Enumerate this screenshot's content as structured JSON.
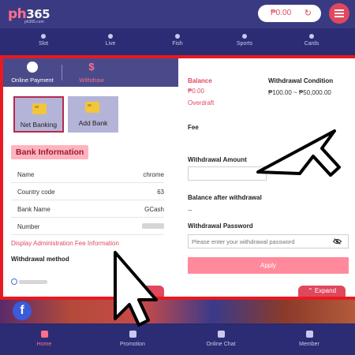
{
  "header": {
    "logo_main": "ph",
    "logo_num": "365",
    "logo_sub": "ph365.com",
    "balance": "₱0.00",
    "refresh_icon": "refresh-icon",
    "menu_icon": "hamburger-icon"
  },
  "nav": {
    "items": [
      {
        "label": "Slot"
      },
      {
        "label": "Live"
      },
      {
        "label": "Fish"
      },
      {
        "label": "Sports"
      },
      {
        "label": "Cards"
      }
    ]
  },
  "tabs": {
    "online_payment": "Online Payment",
    "withdraw": "Withdraw"
  },
  "bank_options": {
    "net_banking": "Net Banking",
    "add_bank": "Add Bank"
  },
  "bank_info": {
    "title": "Bank Information",
    "rows": [
      {
        "key": "Name",
        "value": "chrome"
      },
      {
        "key": "Country code",
        "value": "63"
      },
      {
        "key": "Bank Name",
        "value": "GCash"
      },
      {
        "key": "Number",
        "value": ""
      }
    ]
  },
  "admin_fee_link": "Display Administration Fee Information",
  "withdrawal_method_label": "Withdrawal method",
  "right_panel": {
    "balance_label": "Balance",
    "balance_value": "₱0.00",
    "overdraft_label": "Overdraft",
    "condition_label": "Withdrawal Condition",
    "condition_value": "₱100.00 ~ ₱50,000.00",
    "fee_label": "Fee",
    "amount_label": "Withdrawal Amount",
    "balance_after_label": "Balance after withdrawal",
    "balance_after_value": "--",
    "password_label": "Withdrawal Password",
    "password_placeholder": "Please enter your withdrawal password",
    "apply_label": "Apply"
  },
  "expand_label": "Expand",
  "bottom_nav": {
    "items": [
      {
        "label": "Home"
      },
      {
        "label": "Promotion"
      },
      {
        "label": "Online Chat"
      },
      {
        "label": "Member"
      }
    ]
  },
  "colors": {
    "accent": "#e0485e",
    "highlight_border": "#e81920",
    "header_bg": "#3a3a82",
    "tab_bg": "#4a4a8a",
    "apply_bg": "#ff8a9b"
  }
}
